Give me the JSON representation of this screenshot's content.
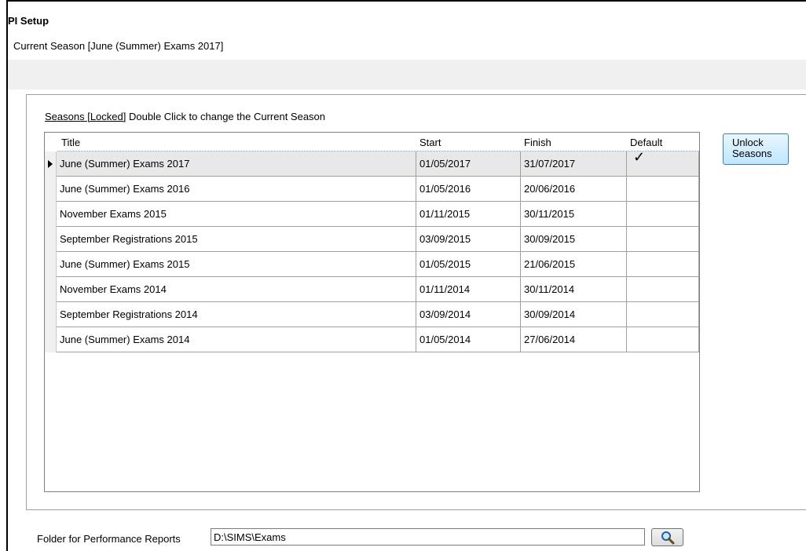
{
  "window": {
    "title": "PI Setup",
    "current_season": "Current Season [June (Summer) Exams 2017]"
  },
  "seasons": {
    "caption_link": "Seasons [Locked]",
    "caption_text": " Double Click to change the Current Season",
    "columns": {
      "title": "Title",
      "start": "Start",
      "finish": "Finish",
      "default": "Default"
    },
    "rows": [
      {
        "title": "June (Summer) Exams 2017",
        "start": "01/05/2017",
        "finish": "31/07/2017",
        "default": true
      },
      {
        "title": "June (Summer) Exams 2016",
        "start": "01/05/2016",
        "finish": "20/06/2016",
        "default": false
      },
      {
        "title": "November Exams 2015",
        "start": "01/11/2015",
        "finish": "30/11/2015",
        "default": false
      },
      {
        "title": "September Registrations 2015",
        "start": "03/09/2015",
        "finish": "30/09/2015",
        "default": false
      },
      {
        "title": "June (Summer) Exams 2015",
        "start": "01/05/2015",
        "finish": "21/06/2015",
        "default": false
      },
      {
        "title": "November Exams 2014",
        "start": "01/11/2014",
        "finish": "30/11/2014",
        "default": false
      },
      {
        "title": "September Registrations 2014",
        "start": "03/09/2014",
        "finish": "30/09/2014",
        "default": false
      },
      {
        "title": "June (Summer) Exams 2014",
        "start": "01/05/2014",
        "finish": "27/06/2014",
        "default": false
      }
    ],
    "default_mark": "✓",
    "unlock_button": {
      "line1": "Unlock",
      "line2": "Seasons"
    }
  },
  "reports_folder": {
    "label": "Folder for Performance Reports",
    "value": "D:\\SIMS\\Exams",
    "browse_icon": "magnifier-icon"
  },
  "colors": {
    "selected_row": "#e8e8e8",
    "button_gradient_top": "#eaf6fd",
    "button_gradient_bottom": "#bee6fd",
    "button_border": "#3c7fb1"
  }
}
